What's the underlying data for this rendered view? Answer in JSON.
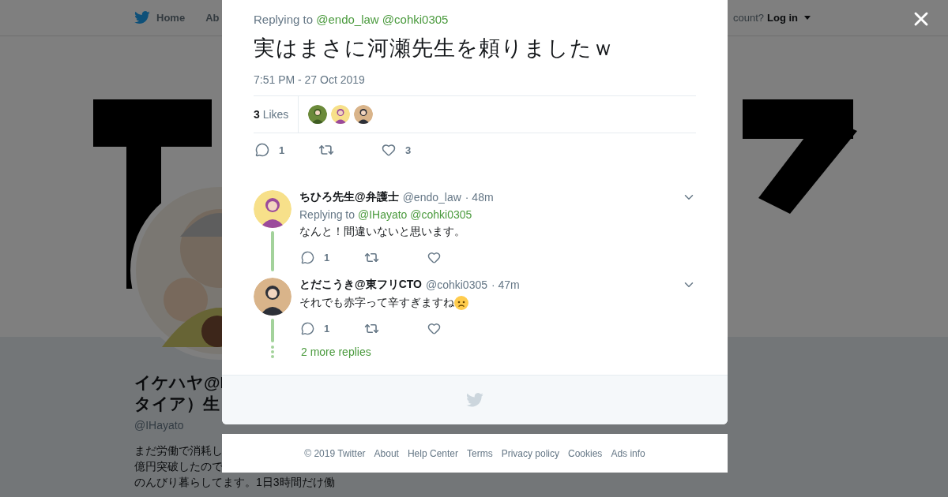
{
  "nav": {
    "items": [
      {
        "label": "Home"
      },
      {
        "label": "Ab"
      }
    ],
    "account_prompt": "count?",
    "login": "Log in"
  },
  "profile": {
    "name_lines": [
      "イケハヤ@I",
      "タイア）生"
    ],
    "handle": "@IHayato",
    "bio_lines": [
      "まだ労働で消耗し",
      "億円突破したので",
      "のんびり暮らしてます。1日3時間だけ働"
    ]
  },
  "tweet": {
    "replying_label": "Replying to",
    "replying_to": [
      "@endo_law",
      "@cohki0305"
    ],
    "text": "実はまさに河瀬先生を頼りましたｗ",
    "time": "7:51 PM - 27 Oct 2019",
    "likes_count": "3",
    "likes_label": "Likes",
    "likers": [
      {
        "kind": "picture"
      },
      {
        "kind": "picture"
      },
      {
        "kind": "picture"
      }
    ],
    "reply_count": "1",
    "like_count": "3"
  },
  "replies": [
    {
      "name": "ちひろ先生@弁護士",
      "handle": "@endo_law",
      "time": "· 48m",
      "replying_label": "Replying to",
      "replying_to": [
        "@IHayato",
        "@cohki0305"
      ],
      "text": "なんと！間違いないと思います。",
      "emoji": false,
      "reply_count": "1"
    },
    {
      "name": "とだこうき@東フリCTO",
      "handle": "@cohki0305",
      "time": "· 47m",
      "text": "それでも赤字って辛すぎますね",
      "emoji": true,
      "reply_count": "1"
    }
  ],
  "more_replies": "2 more replies",
  "footer_links": [
    "© 2019 Twitter",
    "About",
    "Help Center",
    "Terms",
    "Privacy policy",
    "Cookies",
    "Ads info"
  ]
}
